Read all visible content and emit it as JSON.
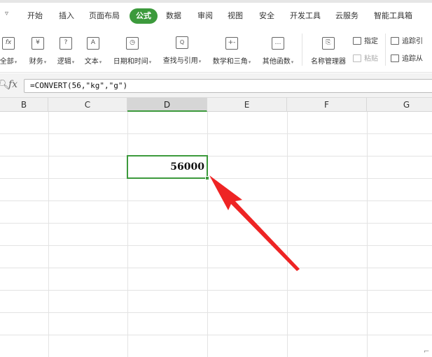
{
  "menubar": {
    "dropdown_icon": "chevron-down-icon",
    "items": [
      "开始",
      "插入",
      "页面布局",
      "公式",
      "数据",
      "审阅",
      "视图",
      "安全",
      "开发工具",
      "云服务",
      "智能工具箱"
    ],
    "active_index": 3,
    "accent": "#3c9a3c"
  },
  "ribbon": {
    "groups": [
      {
        "label": "全部",
        "icon": "fx"
      },
      {
        "label": "财务",
        "icon": "¥"
      },
      {
        "label": "逻辑",
        "icon": "?"
      },
      {
        "label": "文本",
        "icon": "A"
      },
      {
        "label": "日期和时间",
        "icon": "◷"
      },
      {
        "label": "查找与引用",
        "icon": "🔍"
      },
      {
        "label": "数学和三角",
        "icon": "+-"
      },
      {
        "label": "其他函数",
        "icon": "…"
      },
      {
        "label": "名称管理器",
        "icon": "⎘"
      }
    ],
    "small": {
      "specify": "指定",
      "paste": "粘贴",
      "trace_precedents": "追踪引",
      "trace_dependents": "追踪从"
    }
  },
  "formula_bar": {
    "fx": "fx",
    "formula": "=CONVERT(56,\"kg\",\"g\")"
  },
  "sheet": {
    "columns": [
      "B",
      "C",
      "D",
      "E",
      "F",
      "G"
    ],
    "selected_column": "D",
    "active_cell_value": "56000",
    "accent": "#3c9a3c",
    "arrow_color": "#ee2424"
  }
}
